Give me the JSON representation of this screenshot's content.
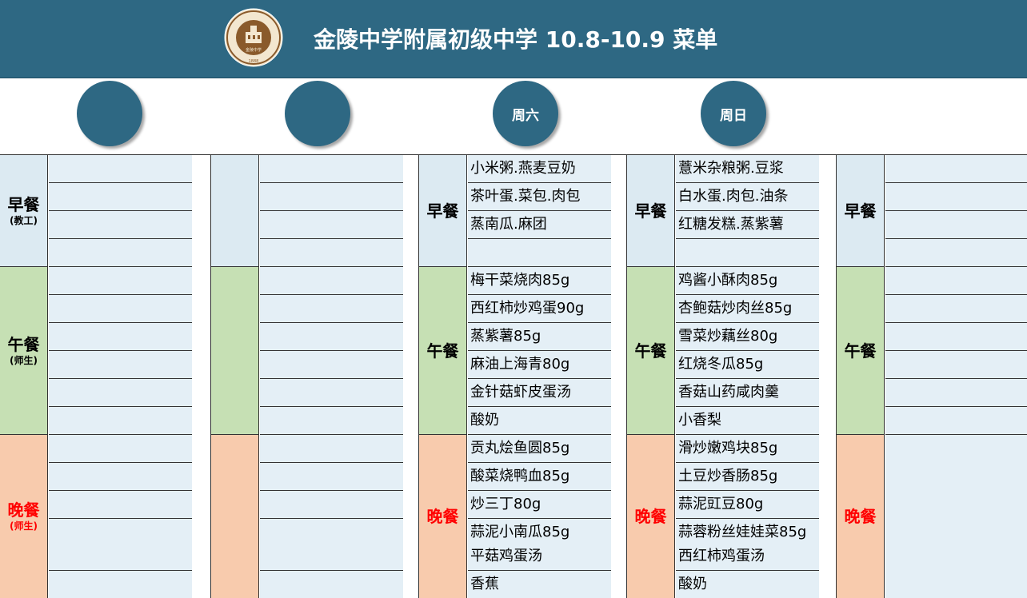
{
  "header": {
    "title": "金陵中学附属初级中学 10.8-10.9 菜单",
    "logo_year": "1888",
    "logo_school": "金陵中学"
  },
  "days": [
    "",
    "",
    "周六",
    "周日",
    ""
  ],
  "meal_labels": {
    "breakfast": "早餐",
    "lunch": "午餐",
    "dinner": "晚餐",
    "breakfast_sub": "(教工)",
    "lunch_sub": "(师生)",
    "dinner_sub": "(师生)"
  },
  "saturday": {
    "breakfast": [
      "小米粥.燕麦豆奶",
      "茶叶蛋.菜包.肉包",
      "蒸南瓜.麻团",
      ""
    ],
    "lunch": [
      "梅干菜烧肉85g",
      "西红柿炒鸡蛋90g",
      "蒸紫薯85g",
      "麻油上海青80g",
      "金针菇虾皮蛋汤",
      "酸奶"
    ],
    "dinner": [
      "贡丸烩鱼圆85g",
      "酸菜烧鸭血85g",
      "炒三丁80g",
      "蒜泥小南瓜85g",
      "平菇鸡蛋汤",
      "香蕉"
    ]
  },
  "sunday": {
    "breakfast": [
      "薏米杂粮粥.豆浆",
      "白水蛋.肉包.油条",
      "红糖发糕.蒸紫薯",
      ""
    ],
    "lunch": [
      "鸡酱小酥肉85g",
      "杏鲍菇炒肉丝85g",
      "雪菜炒藕丝80g",
      "红烧冬瓜85g",
      "香菇山药咸肉羹",
      "小香梨"
    ],
    "dinner": [
      "滑炒嫩鸡块85g",
      "土豆炒香肠85g",
      "蒜泥豇豆80g",
      "蒜蓉粉丝娃娃菜85g",
      "西红柿鸡蛋汤",
      "酸奶"
    ]
  },
  "colors": {
    "header": "#2e6883",
    "breakfast": "#dceaf2",
    "lunch": "#c6e0b4",
    "dinner": "#f8cbad",
    "item": "#e4eff6",
    "dinner_text": "#ff0000"
  }
}
